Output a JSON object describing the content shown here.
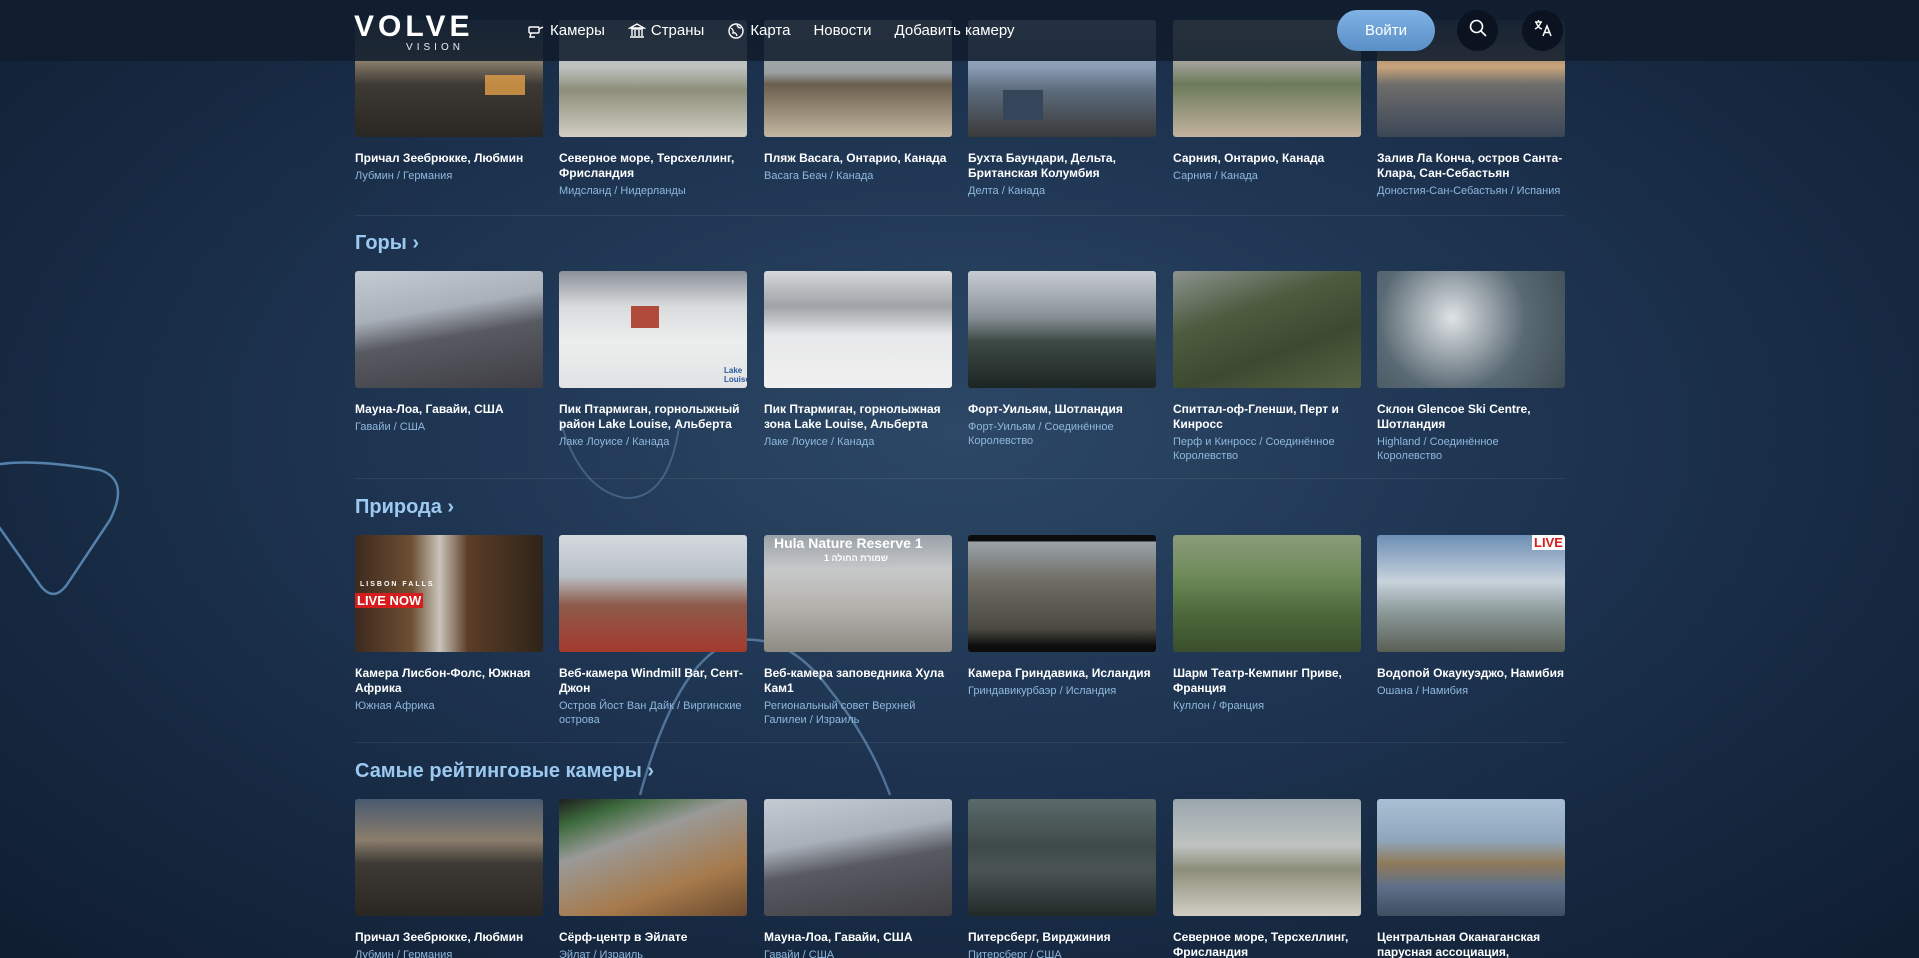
{
  "header": {
    "logo_main": "VOLVE",
    "logo_sub": "VISION",
    "nav": [
      {
        "label": "Камеры",
        "icon": "camera-icon"
      },
      {
        "label": "Страны",
        "icon": "landmark-icon"
      },
      {
        "label": "Карта",
        "icon": "globe-icon"
      },
      {
        "label": "Новости"
      },
      {
        "label": "Добавить камеру"
      }
    ],
    "login_label": "Войти"
  },
  "rows": {
    "beaches": [
      {
        "title": "Причал Зеебрюкке, Любмин",
        "loc": "Лубмин / Германия"
      },
      {
        "title": "Северное море, Терсхеллинг, Фрисландия",
        "loc": "Мидсланд / Нидерланды"
      },
      {
        "title": "Пляж Васага, Онтарио, Канада",
        "loc": "Васага Беач / Канада"
      },
      {
        "title": "Бухта Баундари, Дельта, Британская Колумбия",
        "loc": "Делта / Канада"
      },
      {
        "title": "Сарния, Онтарио, Канада",
        "loc": "Сарния / Канада"
      },
      {
        "title": "Залив Ла Конча, остров Санта-Клара, Сан-Себастьян",
        "loc": "Доностия-Сан-Себастьян / Испания"
      }
    ]
  },
  "sections": [
    {
      "title": "Горы ›",
      "cards": [
        {
          "title": "Мауна-Лоа, Гавайи, США",
          "loc": "Гавайи / США"
        },
        {
          "title": "Пик Птармиган, горнолыжный район Lake Louise, Альберта",
          "loc": "Лаке Лоуисе / Канада"
        },
        {
          "title": "Пик Птармиган, горнолыжная зона Lake Louise, Альберта",
          "loc": "Лаке Лоуисе / Канада"
        },
        {
          "title": "Форт-Уильям, Шотландия",
          "loc": "Форт-Уильям / Соединённое Королевство"
        },
        {
          "title": "Спиттал-оф-Гленши, Перт и Кинросс",
          "loc": "Перф и Кинросс / Соединённое Королевство"
        },
        {
          "title": "Склон Glencoe Ski Centre, Шотландия",
          "loc": "Highland / Соединённое Королевство"
        }
      ]
    },
    {
      "title": "Природа ›",
      "cards": [
        {
          "title": "Камера Лисбон-Фолс, Южная Африка",
          "loc": "Южная Африка"
        },
        {
          "title": "Веб-камера Windmill Bar, Сент-Джон",
          "loc": "Остров Йост Ван Дайк / Виргинские острова"
        },
        {
          "title": "Веб-камера заповедника Хула Кам1",
          "loc": "Региональный совет Верхней Галилеи / Израиль"
        },
        {
          "title": "Камера Гриндавика, Исландия",
          "loc": "Гриндавикурбаэр / Исландия"
        },
        {
          "title": "Шарм Театр-Кемпинг Приве, Франция",
          "loc": "Куллон / Франция"
        },
        {
          "title": "Водопой Окаукуэджо, Намибия",
          "loc": "Ошана / Намибия"
        }
      ]
    },
    {
      "title": "Самые рейтинговые камеры ›",
      "cards": [
        {
          "title": "Причал Зеебрюкке, Любмин",
          "loc": "Лубмин / Германия"
        },
        {
          "title": "Сёрф-центр в Эйлате",
          "loc": "Эйлат / Израиль"
        },
        {
          "title": "Мауна-Лоа, Гавайи, США",
          "loc": "Гавайи / США"
        },
        {
          "title": "Питерсберг, Вирджиния",
          "loc": "Питерсберг / США"
        },
        {
          "title": "Северное море, Терсхеллинг, Фрисландия",
          "loc": ""
        },
        {
          "title": "Центральная Оканаганская парусная ассоциация, Келоуна,...",
          "loc": ""
        }
      ]
    }
  ],
  "overlays": {
    "lisbon_top": "LISBON FALLS",
    "live_now": "LIVE NOW",
    "hula": "Hula Nature Reserve 1",
    "hula_sub": "שמורת החולה 1",
    "live": "LIVE",
    "lake_louise": "Lake Louise"
  },
  "colors": {
    "accent": "#9cc9f0",
    "login": "#6fa3d8",
    "header_bg": "#101c2c"
  }
}
